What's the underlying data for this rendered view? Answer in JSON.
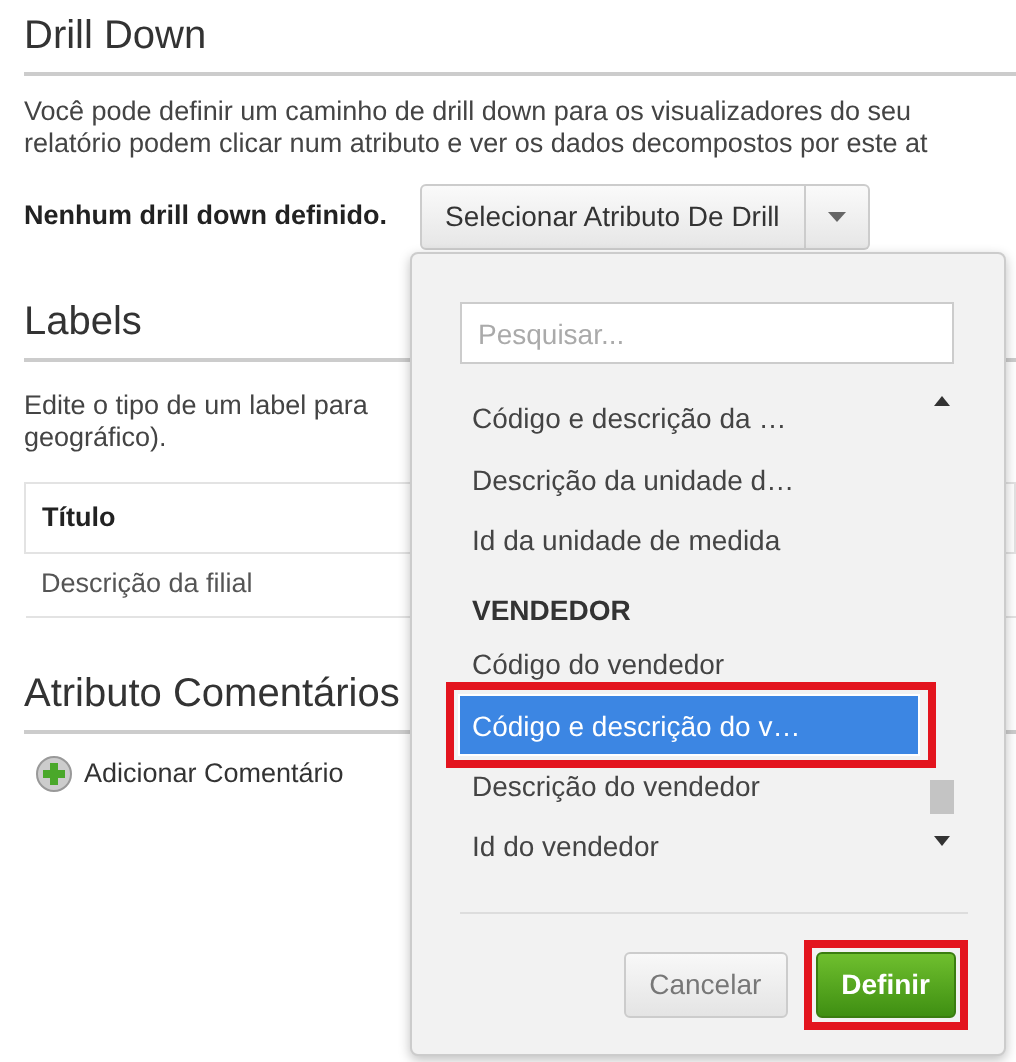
{
  "drill_down": {
    "title": "Drill Down",
    "description_lines": [
      "Você pode definir um caminho de drill down para os visualizadores do seu",
      "relatório podem clicar num atributo e ver os dados decompostos por este at"
    ],
    "status": "Nenhum drill down definido.",
    "select_button": "Selecionar Atributo De Drill"
  },
  "labels": {
    "title": "Labels",
    "description_lines": [
      "Edite o tipo de um label para",
      "geográfico)."
    ],
    "table": {
      "columns": [
        "Título"
      ],
      "rows": [
        [
          "Descrição da filial"
        ]
      ]
    }
  },
  "comments": {
    "title": "Atributo Comentários",
    "add_link": "Adicionar Comentário"
  },
  "dropdown": {
    "search": {
      "placeholder": "Pesquisar..."
    },
    "items": [
      {
        "kind": "item",
        "label": "Código e descrição da …",
        "selected": false,
        "annotated": false
      },
      {
        "kind": "item",
        "label": "Descrição da unidade d…",
        "selected": false,
        "annotated": false
      },
      {
        "kind": "item",
        "label": "Id da unidade de medida",
        "selected": false,
        "annotated": false
      },
      {
        "kind": "group",
        "label": "VENDEDOR"
      },
      {
        "kind": "item",
        "label": "Código do vendedor",
        "selected": false,
        "annotated": false
      },
      {
        "kind": "item",
        "label": "Código e descrição do v…",
        "selected": true,
        "annotated": true
      },
      {
        "kind": "item",
        "label": "Descrição do vendedor",
        "selected": false,
        "annotated": false
      },
      {
        "kind": "item",
        "label": "Id do vendedor",
        "selected": false,
        "annotated": false
      }
    ],
    "buttons": [
      {
        "kind": "cancel",
        "label": "Cancelar",
        "annotated": false
      },
      {
        "kind": "primary",
        "label": "Definir",
        "annotated": true
      }
    ]
  }
}
